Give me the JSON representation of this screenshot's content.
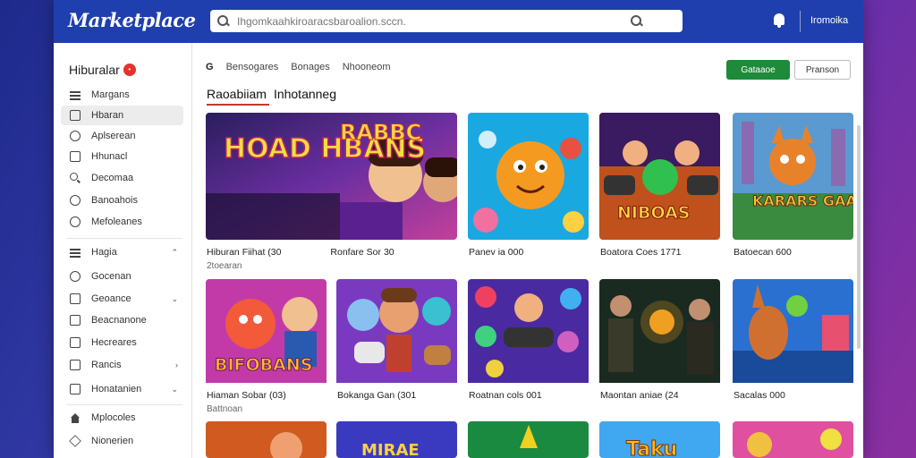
{
  "header": {
    "brand": "Marketplace",
    "search_placeholder": "Ihgomkaahkiroaracsbaroalion.sccn.",
    "user_label": "Iromoika"
  },
  "sidebar": {
    "heading": "Hiburalar",
    "badge": "•",
    "items": [
      {
        "label": "Margans",
        "icon": "menu-lines-icon"
      },
      {
        "label": "Hbaran",
        "icon": "square-icon"
      },
      {
        "label": "Aplserean",
        "icon": "circle-icon"
      },
      {
        "label": "Hhunacl",
        "icon": "square-icon"
      },
      {
        "label": "Decomaa",
        "icon": "search-icon"
      },
      {
        "label": "Banoahois",
        "icon": "circle-icon"
      },
      {
        "label": "Mefoleanes",
        "icon": "circle-icon"
      },
      {
        "label": "Hagia",
        "icon": "menu-lines-icon"
      },
      {
        "label": "Gocenan",
        "icon": "circle-icon"
      },
      {
        "label": "Geoance",
        "icon": "square-icon"
      },
      {
        "label": "Beacnanone",
        "icon": "square-icon"
      },
      {
        "label": "Hecreares",
        "icon": "square-icon"
      },
      {
        "label": "Rancis",
        "icon": "square-icon"
      },
      {
        "label": "Honatanien",
        "icon": "square-icon"
      },
      {
        "label": "Mplocoles",
        "icon": "house-icon"
      },
      {
        "label": "Nionerien",
        "icon": "diamond-icon"
      }
    ]
  },
  "main": {
    "breadcrumbs": [
      "Bensogares",
      "Bonages",
      "Nhooneom"
    ],
    "back_glyph": "G",
    "primary_button": "Gataaoe",
    "secondary_button": "Pranson",
    "section_title": [
      "Raoabiiam",
      "Inhotanneg"
    ],
    "cards": [
      {
        "title": "Hiburan Fiihat",
        "meta": "(30",
        "sub": "2toearan",
        "art": "HOAD HBANS"
      },
      {
        "title": "Ronfare Sor",
        "meta": "30",
        "sub": "",
        "art": "RABBC"
      },
      {
        "title": "Panev ia",
        "meta": "000",
        "sub": ""
      },
      {
        "title": "Boatora Coes",
        "meta": "1771",
        "sub": "",
        "art": "NIBOAS"
      },
      {
        "title": "Batoecan",
        "meta": "600",
        "sub": "",
        "art": "KARARS GAAIES"
      },
      {
        "title": "Hiaman Sobar",
        "meta": "(03)",
        "sub": "Battnoan",
        "art": "BIFOBANS"
      },
      {
        "title": "Bokanga Gan",
        "meta": "(301",
        "sub": ""
      },
      {
        "title": "Roatnan cols",
        "meta": "001",
        "sub": ""
      },
      {
        "title": "Maontan aniae",
        "meta": "(24",
        "sub": ""
      },
      {
        "title": "Sacalas",
        "meta": "000",
        "sub": ""
      },
      {
        "title": "",
        "meta": "",
        "sub": ""
      },
      {
        "title": "",
        "meta": "",
        "sub": "",
        "art": "MIRAE"
      },
      {
        "title": "",
        "meta": "",
        "sub": ""
      },
      {
        "title": "",
        "meta": "",
        "sub": "",
        "art": "Taku"
      },
      {
        "title": "",
        "meta": "",
        "sub": ""
      }
    ]
  },
  "colors": {
    "topbar": "#1f3fae",
    "primary_button": "#1e8a3a",
    "badge": "#e5322d",
    "accent_underline": "#c0392b"
  }
}
